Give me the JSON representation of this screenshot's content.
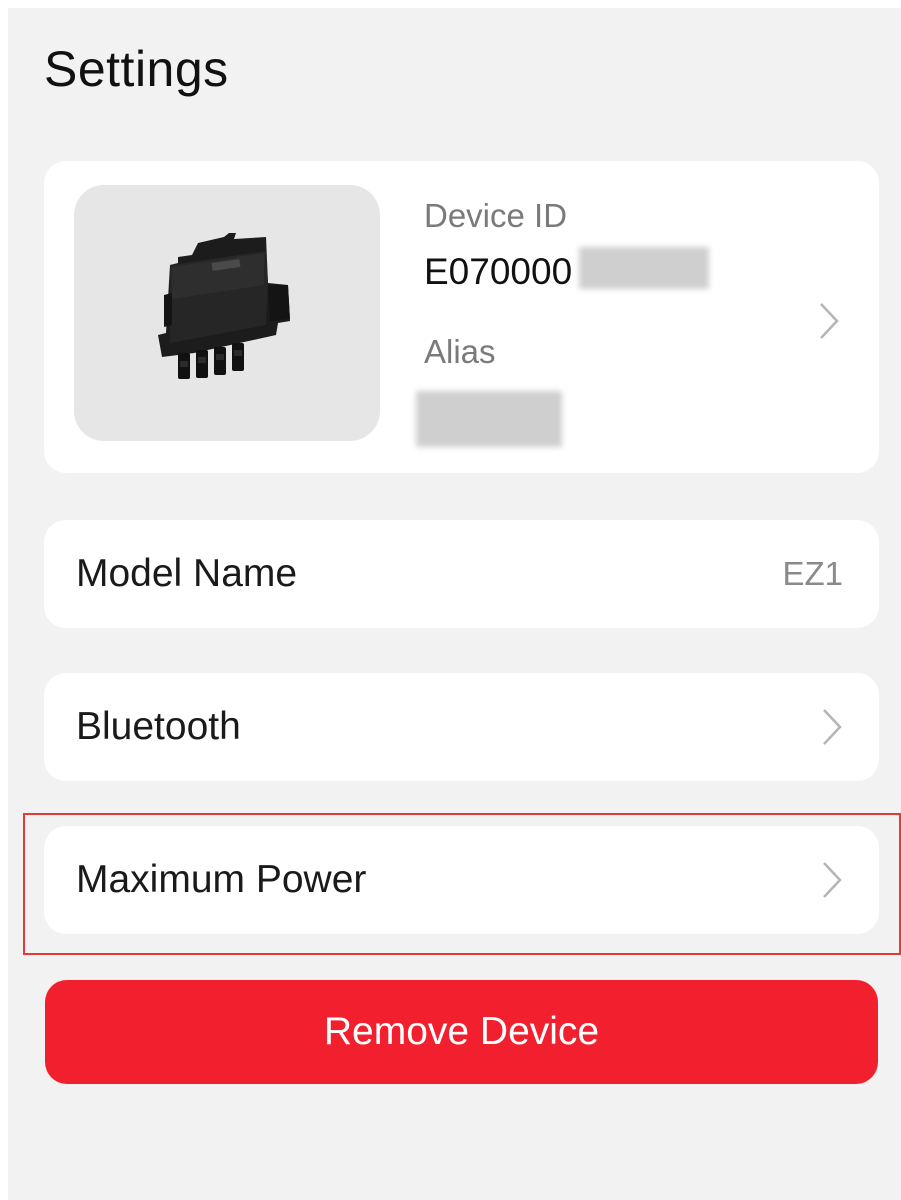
{
  "page": {
    "title": "Settings"
  },
  "device": {
    "image": "microinverter-device-image",
    "id_label": "Device ID",
    "id_value": "E070000",
    "alias_label": "Alias",
    "alias_value": "",
    "chevron_icon": "chevron-right-icon"
  },
  "rows": [
    {
      "label": "Model Name",
      "value": "EZ1"
    },
    {
      "label": "Bluetooth",
      "icon": "chevron-right-icon"
    },
    {
      "label": "Maximum Power",
      "icon": "chevron-right-icon"
    }
  ],
  "remove_button": {
    "label": "Remove Device"
  },
  "colors": {
    "background": "#f2f2f2",
    "card": "#ffffff",
    "danger": "#f2202f",
    "highlight_border": "#e53935",
    "muted_text": "#7a7a7a"
  }
}
